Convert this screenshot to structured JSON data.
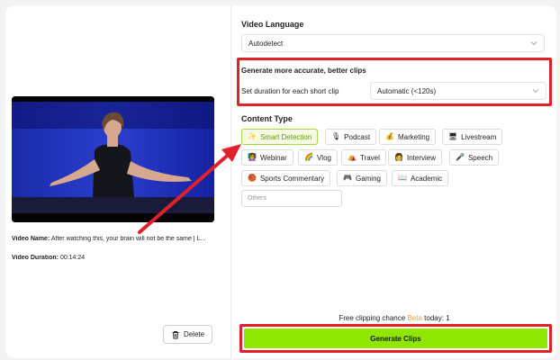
{
  "video": {
    "name_label": "Video Name:",
    "name_value": "After watching this, your brain will not be the same | L...",
    "duration_label": "Video Duration:",
    "duration_value": "00:14:24",
    "delete_label": "Delete"
  },
  "language": {
    "title": "Video Language",
    "selected": "Autodetect"
  },
  "duration_setting": {
    "headline": "Generate more accurate, better clips",
    "label": "Set duration for each short clip",
    "selected": "Automatic (<120s)"
  },
  "content_type": {
    "title": "Content Type",
    "chips": [
      {
        "label": "Smart Detection",
        "icon": "sparkle-icon",
        "glyph": "✨",
        "active": true
      },
      {
        "label": "Podcast",
        "icon": "microphone-icon",
        "glyph": "🎙"
      },
      {
        "label": "Marketing",
        "icon": "money-bag-icon",
        "glyph": "💰"
      },
      {
        "label": "Livestream",
        "icon": "monitor-icon",
        "glyph": "🖥"
      },
      {
        "label": "Webinar",
        "icon": "presenter-icon",
        "glyph": "👩‍🏫"
      },
      {
        "label": "Vlog",
        "icon": "rainbow-icon",
        "glyph": "🌈"
      },
      {
        "label": "Travel",
        "icon": "tent-icon",
        "glyph": "⛺"
      },
      {
        "label": "Interview",
        "icon": "person-icon",
        "glyph": "👩"
      },
      {
        "label": "Speech",
        "icon": "microphone-icon",
        "glyph": "🎤"
      },
      {
        "label": "Sports Commentary",
        "icon": "basketball-icon",
        "glyph": "🏀"
      },
      {
        "label": "Gaming",
        "icon": "gamepad-icon",
        "glyph": "🎮"
      },
      {
        "label": "Academic",
        "icon": "book-icon",
        "glyph": "📖"
      }
    ],
    "others_placeholder": "Others"
  },
  "footer": {
    "chance_prefix": "Free clipping chance",
    "beta": "Beta",
    "chance_suffix": "today: 1",
    "generate_label": "Generate Clips"
  },
  "colors": {
    "accent_green": "#8fe600",
    "highlight_red": "#e2202b",
    "beta_orange": "#f0a030"
  }
}
